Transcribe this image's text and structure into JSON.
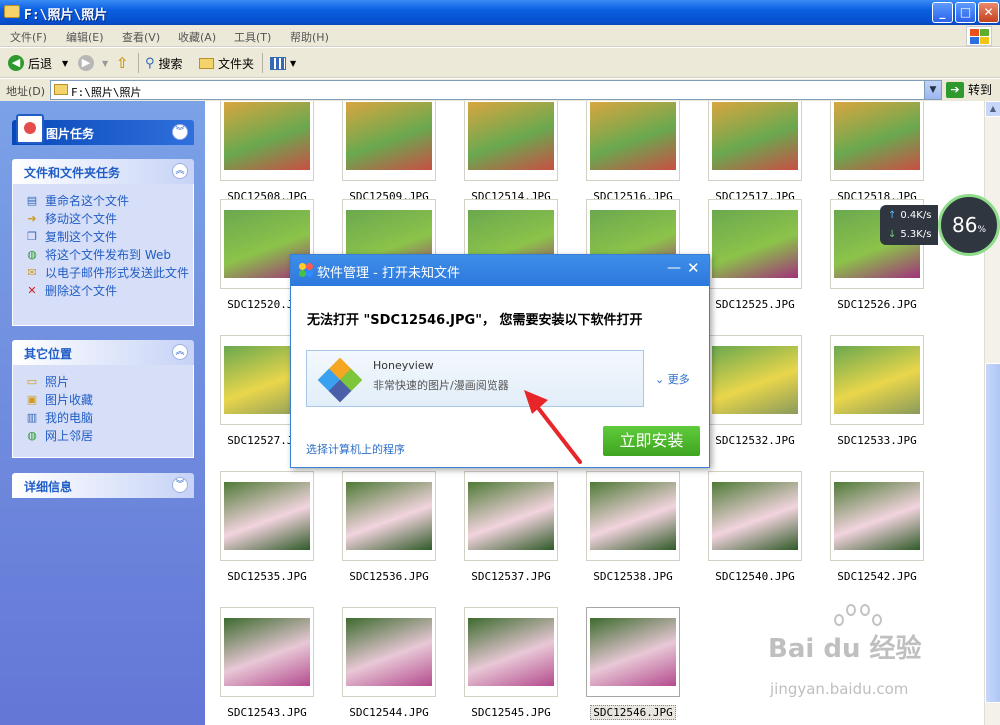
{
  "window": {
    "title": "F:\\照片\\照片",
    "min": "_",
    "max": "□",
    "close": "✕"
  },
  "menu": [
    "文件(F)",
    "编辑(E)",
    "查看(V)",
    "收藏(A)",
    "工具(T)",
    "帮助(H)"
  ],
  "toolbar": {
    "back": "后退",
    "search": "搜索",
    "folders": "文件夹"
  },
  "address": {
    "label": "地址(D)",
    "value": "F:\\照片\\照片",
    "go": "转到"
  },
  "left": {
    "picture_tasks": "图片任务",
    "file_tasks": {
      "title": "文件和文件夹任务",
      "items": [
        "重命名这个文件",
        "移动这个文件",
        "复制这个文件",
        "将这个文件发布到 Web",
        "以电子邮件形式发送此文件",
        "删除这个文件"
      ]
    },
    "other_places": {
      "title": "其它位置",
      "items": [
        "照片",
        "图片收藏",
        "我的电脑",
        "网上邻居"
      ]
    },
    "details": "详细信息"
  },
  "files": [
    [
      "SDC12508.JPG",
      "SDC12509.JPG",
      "SDC12514.JPG",
      "SDC12516.JPG",
      "SDC12517.JPG",
      "SDC12518.JPG"
    ],
    [
      "SDC12520.JPG",
      "",
      "",
      "",
      "SDC12525.JPG",
      "SDC12526.JPG"
    ],
    [
      "SDC12527.JPG",
      "",
      "",
      "",
      "SDC12532.JPG",
      "SDC12533.JPG"
    ],
    [
      "SDC12535.JPG",
      "SDC12536.JPG",
      "SDC12537.JPG",
      "SDC12538.JPG",
      "SDC12540.JPG",
      "SDC12542.JPG"
    ],
    [
      "SDC12543.JPG",
      "SDC12544.JPG",
      "SDC12545.JPG",
      "SDC12546.JPG"
    ]
  ],
  "net": {
    "up": "0.4K/s",
    "down": "5.3K/s",
    "percent": "86",
    "unit": "%"
  },
  "dialog": {
    "title": "软件管理 - 打开未知文件",
    "message": "无法打开 \"SDC12546.JPG\"， 您需要安装以下软件打开",
    "app_name": "Honeyview",
    "app_desc": "非常快速的图片/漫画阅览器",
    "more": "更多",
    "choose": "选择计算机上的程序",
    "install": "立即安装"
  },
  "watermark": {
    "main": "Bai du 经验",
    "sub": "jingyan.baidu.com"
  },
  "colors": {
    "xp_blue": "#0a5fe0",
    "panel_link": "#215dc6",
    "install_green": "#3fa521"
  }
}
